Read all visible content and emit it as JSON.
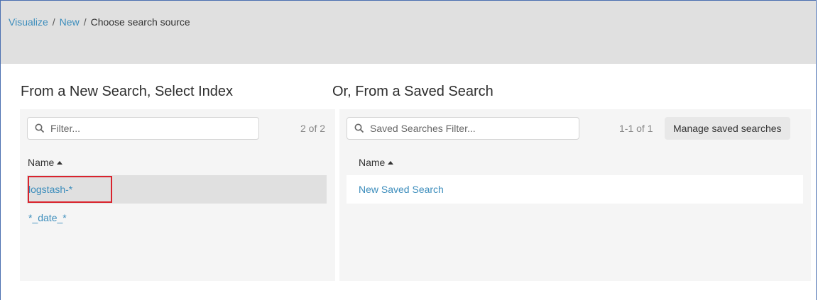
{
  "breadcrumb": {
    "visualize": "Visualize",
    "sep1": "/",
    "new": "New",
    "sep2": "/",
    "current": "Choose search source"
  },
  "left": {
    "title": "From a New Search, Select Index",
    "filter_placeholder": "Filter...",
    "count": "2 of 2",
    "column_header": "Name",
    "items": [
      "logstash-*",
      "*_date_*"
    ]
  },
  "right": {
    "title": "Or, From a Saved Search",
    "filter_placeholder": "Saved Searches Filter...",
    "count": "1-1 of 1",
    "manage_label": "Manage saved searches",
    "column_header": "Name",
    "items": [
      "New Saved Search"
    ]
  },
  "colors": {
    "link": "#3c8dbc",
    "highlight_border": "#d9232d",
    "topbar": "#e0e0e0",
    "panel": "#f5f5f5"
  },
  "icons": {
    "filter": "search-icon",
    "sort": "sort-ascending-icon"
  }
}
